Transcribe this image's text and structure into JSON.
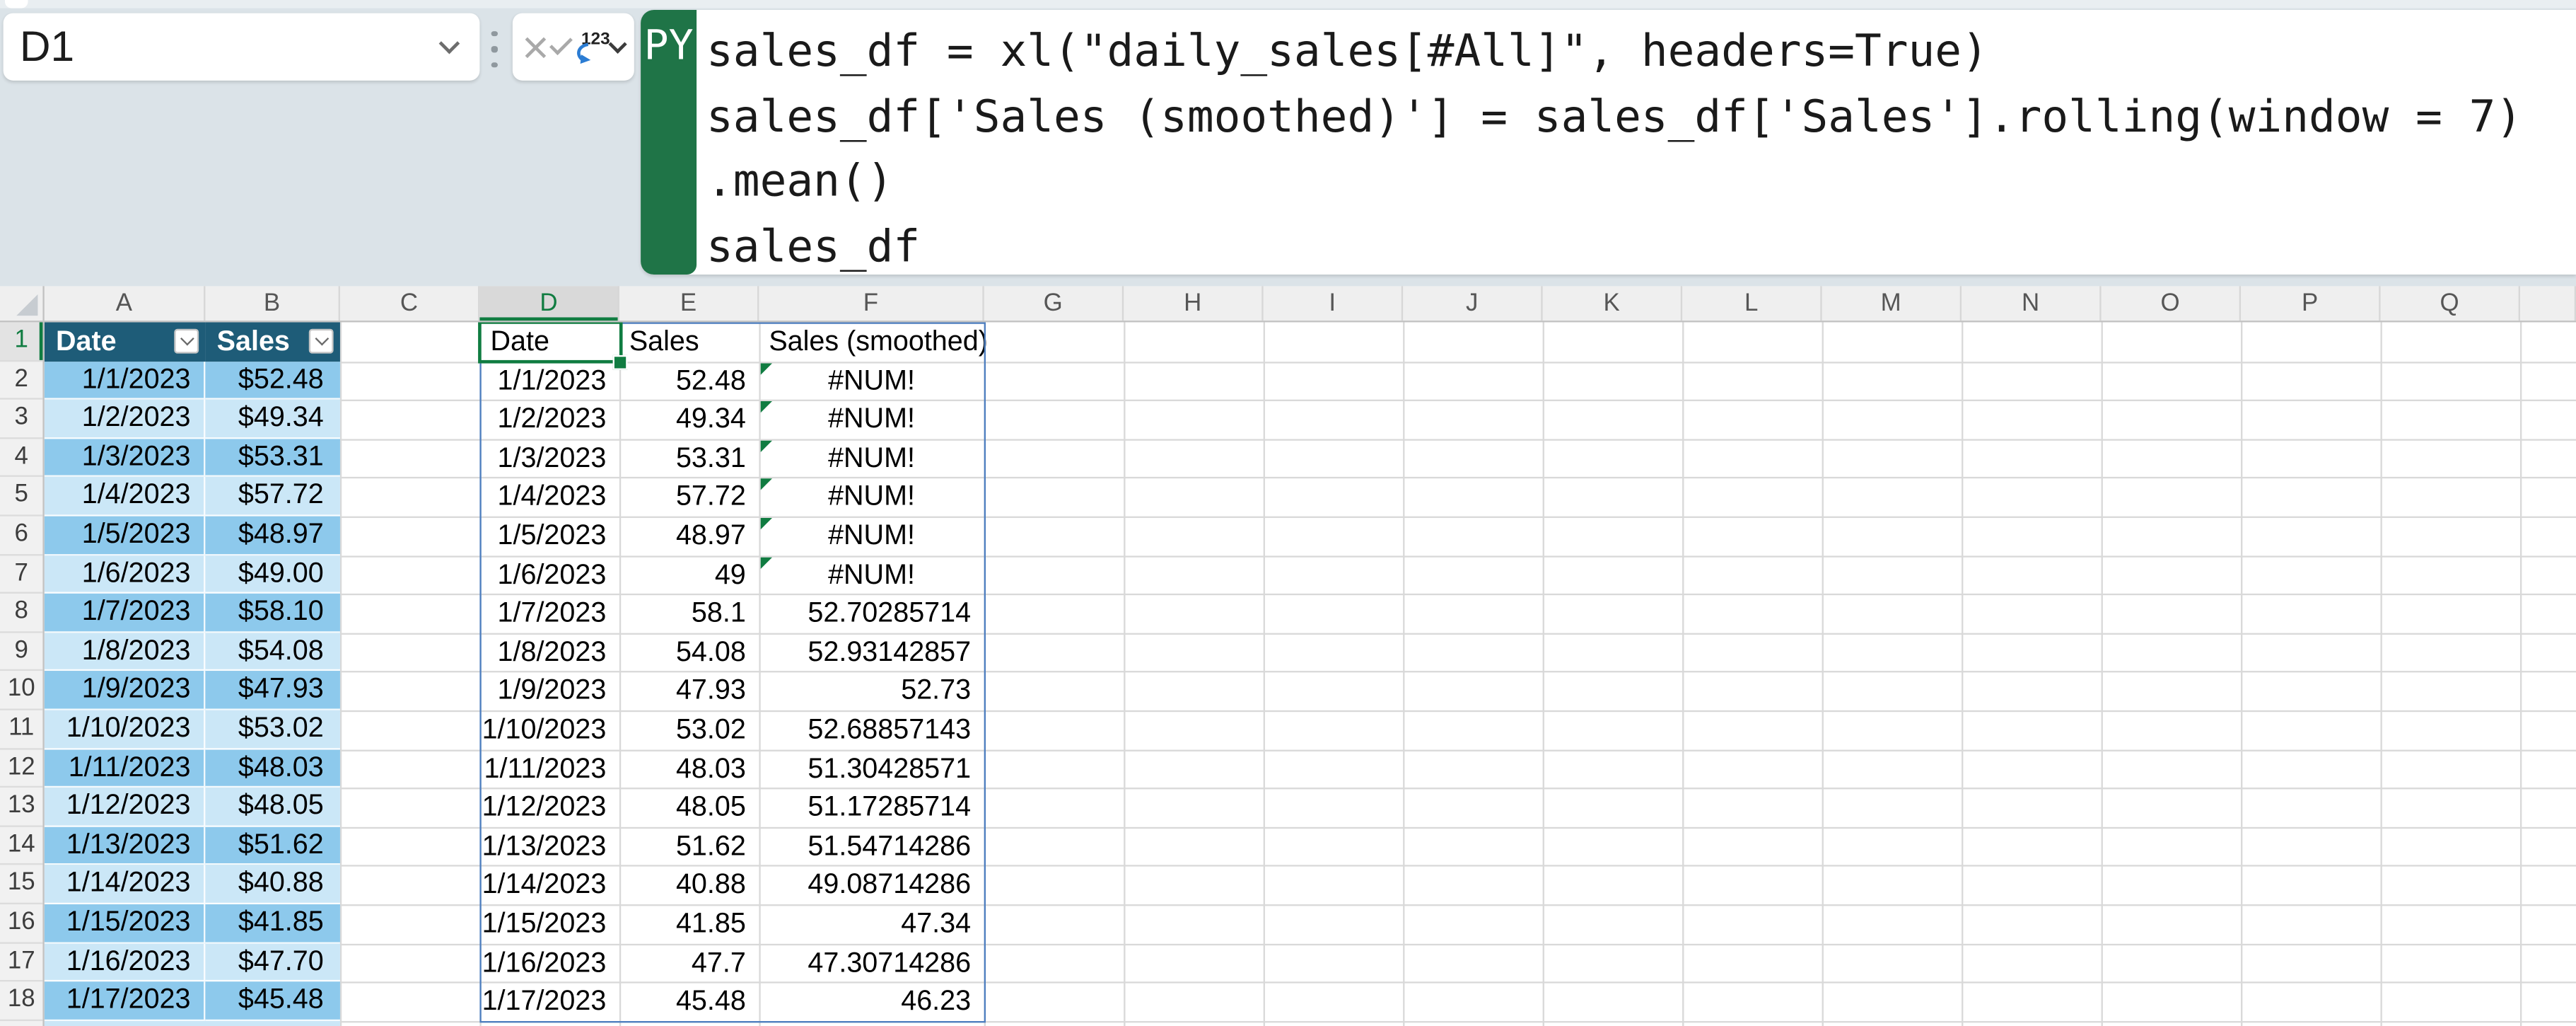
{
  "name_box": {
    "value": "D1"
  },
  "toolbar": {
    "cancel_icon": "cancel",
    "enter_icon": "enter",
    "number_format_label": "123"
  },
  "formula_bar": {
    "language_badge": "PY",
    "lines": [
      "sales_df = xl(\"daily_sales[#All]\", headers=True)",
      "sales_df['Sales (smoothed)'] = sales_df['Sales'].rolling(window = 7)",
      ".mean()",
      "sales_df"
    ]
  },
  "grid": {
    "column_letters": [
      "A",
      "B",
      "C",
      "D",
      "E",
      "F",
      "G",
      "H",
      "I",
      "J",
      "K",
      "L",
      "M",
      "N",
      "O",
      "P",
      "Q"
    ],
    "selected_column": "D",
    "selected_row": 1,
    "selected_cell": "D1",
    "visible_rows": 18
  },
  "sheet_table": {
    "headers": [
      "Date",
      "Sales"
    ],
    "rows": [
      [
        "1/1/2023",
        "$52.48"
      ],
      [
        "1/2/2023",
        "$49.34"
      ],
      [
        "1/3/2023",
        "$53.31"
      ],
      [
        "1/4/2023",
        "$57.72"
      ],
      [
        "1/5/2023",
        "$48.97"
      ],
      [
        "1/6/2023",
        "$49.00"
      ],
      [
        "1/7/2023",
        "$58.10"
      ],
      [
        "1/8/2023",
        "$54.08"
      ],
      [
        "1/9/2023",
        "$47.93"
      ],
      [
        "1/10/2023",
        "$53.02"
      ],
      [
        "1/11/2023",
        "$48.03"
      ],
      [
        "1/12/2023",
        "$48.05"
      ],
      [
        "1/13/2023",
        "$51.62"
      ],
      [
        "1/14/2023",
        "$40.88"
      ],
      [
        "1/15/2023",
        "$41.85"
      ],
      [
        "1/16/2023",
        "$47.70"
      ],
      [
        "1/17/2023",
        "$45.48"
      ]
    ]
  },
  "python_output": {
    "headers": [
      "Date",
      "Sales",
      "Sales (smoothed)"
    ],
    "rows": [
      {
        "date": "1/1/2023",
        "sales": "52.48",
        "smoothed": "#NUM!",
        "error": true
      },
      {
        "date": "1/2/2023",
        "sales": "49.34",
        "smoothed": "#NUM!",
        "error": true
      },
      {
        "date": "1/3/2023",
        "sales": "53.31",
        "smoothed": "#NUM!",
        "error": true
      },
      {
        "date": "1/4/2023",
        "sales": "57.72",
        "smoothed": "#NUM!",
        "error": true
      },
      {
        "date": "1/5/2023",
        "sales": "48.97",
        "smoothed": "#NUM!",
        "error": true
      },
      {
        "date": "1/6/2023",
        "sales": "49",
        "smoothed": "#NUM!",
        "error": true
      },
      {
        "date": "1/7/2023",
        "sales": "58.1",
        "smoothed": "52.70285714",
        "error": false
      },
      {
        "date": "1/8/2023",
        "sales": "54.08",
        "smoothed": "52.93142857",
        "error": false
      },
      {
        "date": "1/9/2023",
        "sales": "47.93",
        "smoothed": "52.73",
        "error": false
      },
      {
        "date": "1/10/2023",
        "sales": "53.02",
        "smoothed": "52.68857143",
        "error": false
      },
      {
        "date": "1/11/2023",
        "sales": "48.03",
        "smoothed": "51.30428571",
        "error": false
      },
      {
        "date": "1/12/2023",
        "sales": "48.05",
        "smoothed": "51.17285714",
        "error": false
      },
      {
        "date": "1/13/2023",
        "sales": "51.62",
        "smoothed": "51.54714286",
        "error": false
      },
      {
        "date": "1/14/2023",
        "sales": "40.88",
        "smoothed": "49.08714286",
        "error": false
      },
      {
        "date": "1/15/2023",
        "sales": "41.85",
        "smoothed": "47.34",
        "error": false
      },
      {
        "date": "1/16/2023",
        "sales": "47.7",
        "smoothed": "47.30714286",
        "error": false
      },
      {
        "date": "1/17/2023",
        "sales": "45.48",
        "smoothed": "46.23",
        "error": false
      }
    ]
  },
  "colors": {
    "py_green": "#1f7447",
    "sel_green": "#107c41",
    "teal": "#1e5c78",
    "band_dark": "#8dc9ec",
    "band_light": "#cbe7f7",
    "range_blue": "#4d7ebf",
    "err_green": "#107c41",
    "panel": "#dbe3e8",
    "strip": "#e9eef1",
    "grid_line": "#d9d9d9",
    "head_bg": "#efefef",
    "head_sel_bg": "#d9d9d9",
    "gutter_bg": "#f1f1f1",
    "gutter_sel_bg": "#e3e3e3"
  }
}
